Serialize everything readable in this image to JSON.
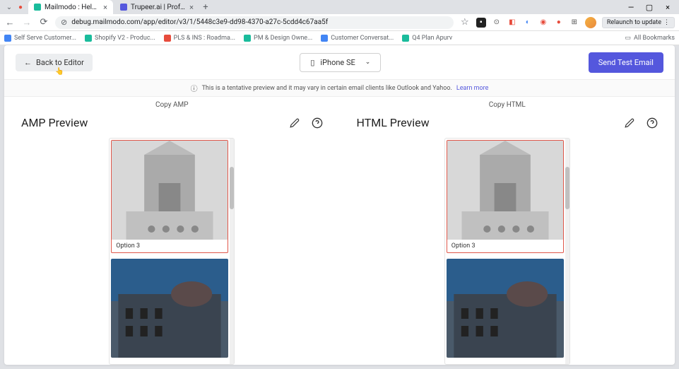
{
  "browser": {
    "tabs": [
      {
        "title": "Mailmodo : Helping marketers",
        "favicon": "#1abc9c"
      },
      {
        "title": "Trupeer.ai | Professional Video",
        "favicon": "#5457dd"
      }
    ],
    "url": "debug.mailmodo.com/app/editor/v3/1/5448c3e9-dd98-4370-a27c-5cdd4c67aa5f",
    "bookmarks": [
      {
        "label": "Self Serve Customer..."
      },
      {
        "label": "Shopify V2 - Produc..."
      },
      {
        "label": "PLS & INS : Roadma..."
      },
      {
        "label": "PM & Design Owne..."
      },
      {
        "label": "Customer Conversat..."
      },
      {
        "label": "Q4 Plan Apurv"
      }
    ],
    "relaunch_label": "Relaunch to update",
    "all_bookmarks": "All Bookmarks"
  },
  "app": {
    "back_label": "Back to Editor",
    "device_label": "iPhone SE",
    "send_test_label": "Send Test Email",
    "warning_text": "This is a tentative preview and it may vary in certain email clients like Outlook and Yahoo.",
    "learn_more": "Learn more",
    "previews": [
      {
        "copy_label": "Copy AMP",
        "title": "AMP Preview",
        "option_caption": "Option 3"
      },
      {
        "copy_label": "Copy HTML",
        "title": "HTML Preview",
        "option_caption": "Option 3"
      }
    ]
  }
}
